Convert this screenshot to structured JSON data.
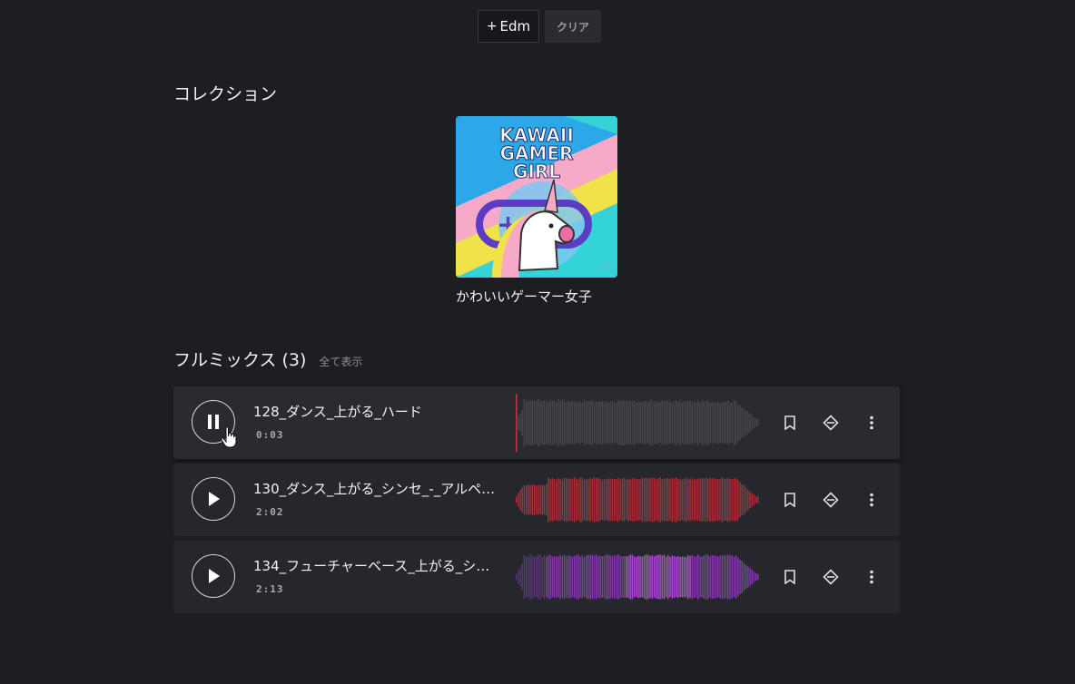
{
  "filters": {
    "edm_plus": "+",
    "edm_label": "Edm",
    "clear_label": "クリア"
  },
  "collections": {
    "title": "コレクション",
    "items": [
      {
        "name": "かわいいゲーマー女子",
        "cover_text": [
          "KAWAII",
          "GAMER",
          "GIRL"
        ]
      }
    ]
  },
  "fullmix": {
    "title": "フルミックス (3)",
    "show_all": "全て表示",
    "tracks": [
      {
        "name": "128_ダンス_上がる_ハード",
        "time": "0:03",
        "state": "playing",
        "progress": 0.0,
        "wave_color": "#4a4a4e",
        "played_color": "#c0353f"
      },
      {
        "name": "130_ダンス_上がる_シンセ_-_アルペ…",
        "time": "2:02",
        "state": "paused",
        "wave_color": "#b3323f"
      },
      {
        "name": "134_フューチャーベース_上がる_シ…",
        "time": "2:13",
        "state": "paused",
        "wave_color": "#9a44c2"
      }
    ]
  },
  "icons": [
    "pause-icon",
    "play-icon",
    "bookmark-icon",
    "diamond-icon",
    "more-vert-icon",
    "hand-cursor-icon"
  ]
}
